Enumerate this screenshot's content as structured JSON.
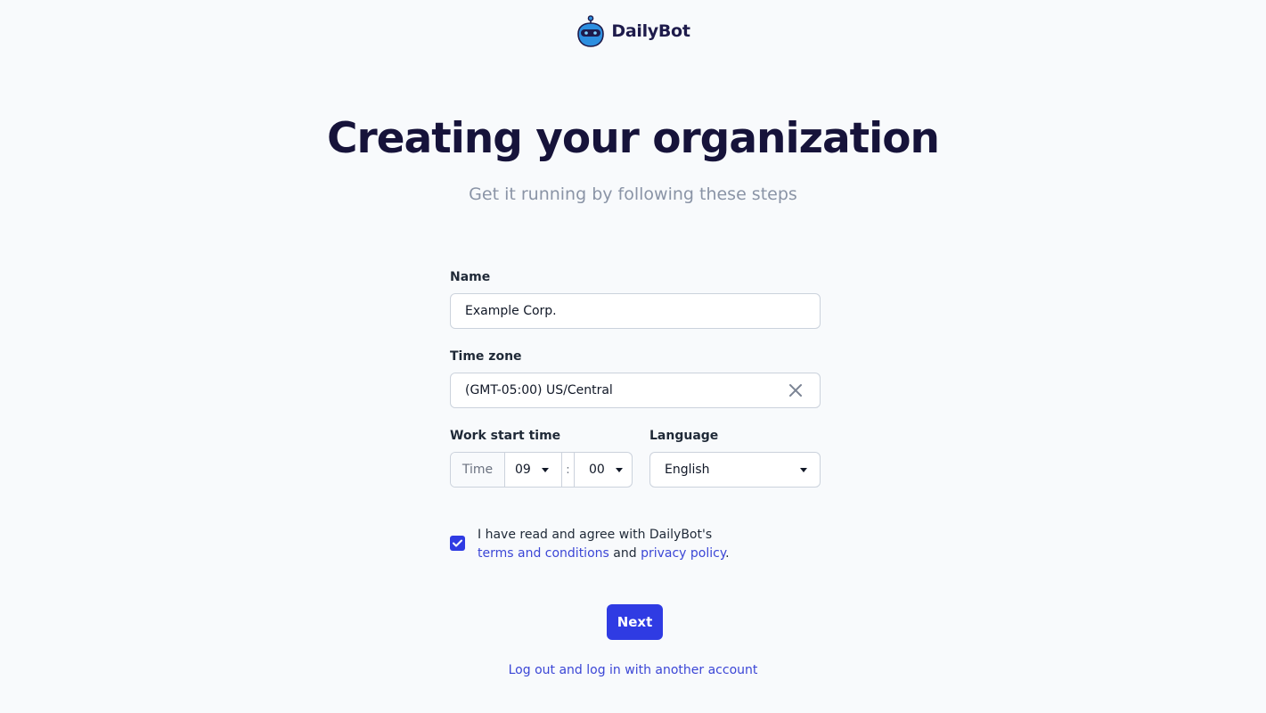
{
  "brand": {
    "name": "DailyBot",
    "logo_icon": "robot-icon",
    "logo_colors": {
      "head": "#2d8fe0",
      "outline": "#1e1b4b",
      "face": "#1e1b4b"
    }
  },
  "header": {
    "title": "Creating your organization",
    "subtitle": "Get it running by following these steps"
  },
  "form": {
    "name": {
      "label": "Name",
      "value": "Example Corp."
    },
    "timezone": {
      "label": "Time zone",
      "value": "(GMT-05:00) US/Central",
      "clear_icon": "close-icon"
    },
    "work_start": {
      "label": "Work start time",
      "addon": "Time",
      "hour": "09",
      "separator": ":",
      "minute": "00"
    },
    "language": {
      "label": "Language",
      "value": "English"
    }
  },
  "agreement": {
    "checked": true,
    "text_before": "I have read and agree with DailyBot's",
    "terms_link": "terms and conditions",
    "and_text": " and ",
    "privacy_link": "privacy policy",
    "end_text": "."
  },
  "actions": {
    "next_label": "Next",
    "logout_label": "Log out and log in with another account"
  },
  "colors": {
    "primary": "#2f3be3",
    "link": "#3b46d6",
    "background": "#f8fafc",
    "title": "#16133a",
    "muted": "#8a94a6"
  }
}
